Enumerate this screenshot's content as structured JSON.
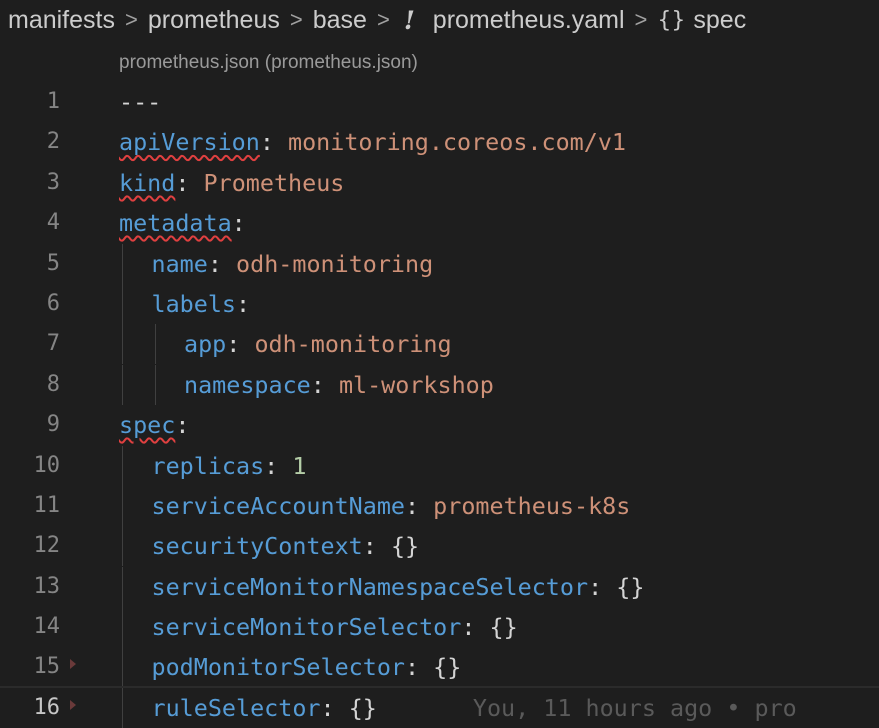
{
  "breadcrumb": {
    "items": [
      "manifests",
      "prometheus",
      "base"
    ],
    "file_icon": "!",
    "file": "prometheus.yaml",
    "symbol_icon": "{}",
    "symbol": "spec",
    "separator": ">"
  },
  "schema_hint": "prometheus.json (prometheus.json)",
  "lines": [
    {
      "n": "1",
      "indent": 0,
      "doc": "---"
    },
    {
      "n": "2",
      "indent": 0,
      "key": "apiVersion",
      "value": "monitoring.coreos.com/v1",
      "vtype": "str",
      "squiggly": true
    },
    {
      "n": "3",
      "indent": 0,
      "key": "kind",
      "value": "Prometheus",
      "vtype": "str",
      "squiggly": true
    },
    {
      "n": "4",
      "indent": 0,
      "key": "metadata",
      "value": "",
      "squiggly": true
    },
    {
      "n": "5",
      "indent": 1,
      "key": "name",
      "value": "odh-monitoring",
      "vtype": "str"
    },
    {
      "n": "6",
      "indent": 1,
      "key": "labels",
      "value": ""
    },
    {
      "n": "7",
      "indent": 2,
      "key": "app",
      "value": "odh-monitoring",
      "vtype": "str"
    },
    {
      "n": "8",
      "indent": 2,
      "key": "namespace",
      "value": "ml-workshop",
      "vtype": "str"
    },
    {
      "n": "9",
      "indent": 0,
      "key": "spec",
      "value": "",
      "squiggly": true
    },
    {
      "n": "10",
      "indent": 1,
      "key": "replicas",
      "value": "1",
      "vtype": "num"
    },
    {
      "n": "11",
      "indent": 1,
      "key": "serviceAccountName",
      "value": "prometheus-k8s",
      "vtype": "str"
    },
    {
      "n": "12",
      "indent": 1,
      "key": "securityContext",
      "value": "{}",
      "vtype": "brace"
    },
    {
      "n": "13",
      "indent": 1,
      "key": "serviceMonitorNamespaceSelector",
      "value": "{}",
      "vtype": "brace"
    },
    {
      "n": "14",
      "indent": 1,
      "key": "serviceMonitorSelector",
      "value": "{}",
      "vtype": "brace"
    },
    {
      "n": "15",
      "indent": 1,
      "key": "podMonitorSelector",
      "value": "{}",
      "vtype": "brace",
      "fold": true
    },
    {
      "n": "16",
      "indent": 1,
      "key": "ruleSelector",
      "value": "{}",
      "vtype": "brace",
      "fold": true,
      "current": true,
      "blame": "You, 11 hours ago • pro"
    }
  ],
  "colors": {
    "background": "#1e1e1e",
    "key": "#569cd6",
    "string": "#ce9178",
    "number": "#b5cea8",
    "error_squiggle": "#e04040",
    "line_number": "#858585"
  }
}
